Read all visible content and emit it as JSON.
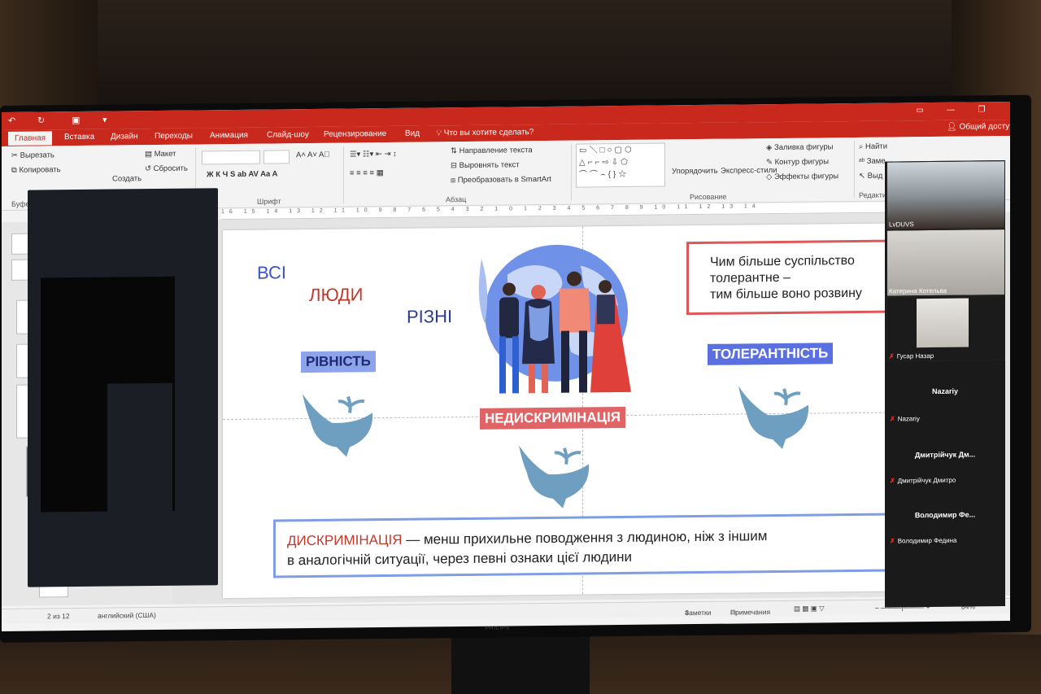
{
  "qat": {
    "undo": "↶",
    "redo": "↻"
  },
  "tabs": [
    "Главная",
    "Вставка",
    "Дизайн",
    "Переходы",
    "Анимация",
    "Слайд-шоу",
    "Рецензирование",
    "Вид"
  ],
  "tell_me": "Что вы хотите сделать?",
  "share": "Общий досту",
  "ribbon": {
    "clipboard": {
      "cut": "Вырезать",
      "copy": "Копировать",
      "create": "Создать",
      "group": "Буфе"
    },
    "slides": {
      "layout": "Макет",
      "reset": "Сбросить"
    },
    "font": {
      "group": "Шрифт",
      "buttons": "Ж  К  Ч  S  ab  AV  Aa  A"
    },
    "paragraph": {
      "group": "Абзац",
      "text_direction": "Направление текста",
      "align_text": "Выровнять текст",
      "smartart": "Преобразовать в SmartArt"
    },
    "drawing": {
      "group": "Рисование",
      "arrange": "Упорядочить",
      "quick_styles": "Экспресс-стили",
      "fill": "Заливка фигуры",
      "outline": "Контур фигуры",
      "effects": "Эффекты фигуры"
    },
    "editing": {
      "find": "Найти",
      "replace": "Заме",
      "select": "Выд",
      "group": "Редакти"
    }
  },
  "ruler": "16 15 14 13 12 11 10 9 8 7 6 5 4 3 2 1 0 1 2 3 4 5 6 7 8 9 10 11 12 13 14",
  "slide": {
    "words": {
      "w1": "ВСІ",
      "w2": "ЛЮДИ",
      "w3": "РІЗНІ"
    },
    "equality": "РІВНІСТЬ",
    "tolerance": "ТОЛЕРАНТНІСТЬ",
    "nondiscrimination": "НЕДИСКРИМІНАЦІЯ",
    "quote": {
      "line1": "Чим більше суспільство",
      "line2": "толерантне –",
      "line3": "тим більше воно розвину"
    },
    "definition": {
      "term": "ДИСКРИМІНАЦІЯ",
      "line1_rest": " — менш прихильне поводження з людиною, ніж з іншим",
      "line2": "в аналогічній ситуації, через певні ознаки цієї людини"
    },
    "colors": {
      "blue": "#3a55c8",
      "red": "#c0392b",
      "dark_blue": "#2b3a8a",
      "pill_blue": "#8da4ea",
      "pill_blue2": "#5a6fe0",
      "pill_red": "#e06466",
      "whale": "#6e9ec0"
    }
  },
  "status": {
    "slide_of": "2 из 12",
    "language": "английский (США)",
    "notes": "Заметки",
    "comments": "Примечания",
    "zoom": "84%"
  },
  "zoom": {
    "participants": [
      {
        "name": "LvDUVS"
      },
      {
        "name": "Катерина Котельва"
      },
      {
        "name": "Гусар Назар"
      },
      {
        "display": "Nazariy",
        "name": "Nazariy"
      },
      {
        "display": "Дмитрійчук Дм...",
        "name": "Дмитрійчук Дмитро"
      },
      {
        "display": "Володимир  Фе...",
        "name": "Володимир Федина"
      }
    ]
  },
  "monitor_brand": "PHILIPS"
}
